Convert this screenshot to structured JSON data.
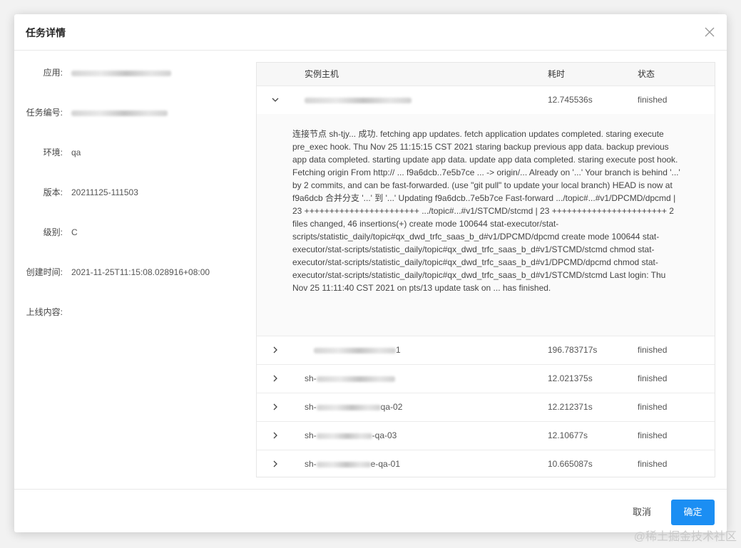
{
  "dialog": {
    "title": "任务详情",
    "close_icon": "close-icon"
  },
  "details": {
    "fields": [
      {
        "label": "应用:",
        "value": ""
      },
      {
        "label": "任务编号:",
        "value": ""
      },
      {
        "label": "环境:",
        "value": "qa"
      },
      {
        "label": "版本:",
        "value": "20211125-111503"
      },
      {
        "label": "级别:",
        "value": "C"
      },
      {
        "label": "创建时间:",
        "value": "2021-11-25T11:15:08.028916+08:00"
      },
      {
        "label": "上线内容:",
        "value": ""
      }
    ]
  },
  "table": {
    "columns": {
      "host": "实例主机",
      "duration": "耗时",
      "status": "状态"
    },
    "rows": [
      {
        "host": "",
        "duration": "12.745536s",
        "status": "finished",
        "expanded": true
      },
      {
        "host": "1",
        "duration": "196.783717s",
        "status": "finished",
        "expanded": false
      },
      {
        "host": "sh-",
        "duration": "12.021375s",
        "status": "finished",
        "expanded": false
      },
      {
        "host": "sh-",
        "host_suffix": "qa-02",
        "duration": "12.212371s",
        "status": "finished",
        "expanded": false
      },
      {
        "host": "sh-",
        "host_suffix": "-qa-03",
        "duration": "12.10677s",
        "status": "finished",
        "expanded": false
      },
      {
        "host": "sh-",
        "host_suffix": "e-qa-01",
        "duration": "10.665087s",
        "status": "finished",
        "expanded": false
      }
    ],
    "expanded_log": "连接节点 sh-tjy... 成功. fetching app updates. fetch application updates completed. staring execute pre_exec hook. Thu Nov 25 11:15:15 CST 2021 staring backup previous app data. backup previous app data completed. starting update app data. update app data completed. staring execute post hook. Fetching origin From http:// ... f9a6dcb..7e5b7ce ... -> origin/... Already on '...' Your branch is behind '...' by 2 commits, and can be fast-forwarded. (use \"git pull\" to update your local branch) HEAD is now at f9a6dcb 合并分支 '...' 到 '...' Updating f9a6dcb..7e5b7ce Fast-forward .../topic#...#v1/DPCMD/dpcmd | 23 +++++++++++++++++++++++ .../topic#...#v1/STCMD/stcmd | 23 +++++++++++++++++++++++ 2 files changed, 46 insertions(+) create mode 100644 stat-executor/stat-scripts/statistic_daily/topic#qx_dwd_trfc_saas_b_d#v1/DPCMD/dpcmd create mode 100644 stat-executor/stat-scripts/statistic_daily/topic#qx_dwd_trfc_saas_b_d#v1/STCMD/stcmd chmod stat-executor/stat-scripts/statistic_daily/topic#qx_dwd_trfc_saas_b_d#v1/DPCMD/dpcmd chmod stat-executor/stat-scripts/statistic_daily/topic#qx_dwd_trfc_saas_b_d#v1/STCMD/stcmd Last login: Thu Nov 25 11:11:40 CST 2021 on pts/13 update task on ... has finished."
  },
  "footer": {
    "cancel_label": "取消",
    "ok_label": "确定"
  },
  "watermark": "@稀土掘金技术社区",
  "colors": {
    "primary": "#1b8ef3",
    "header_bg": "#f7f7f7",
    "expand_bg": "#fafafa"
  }
}
